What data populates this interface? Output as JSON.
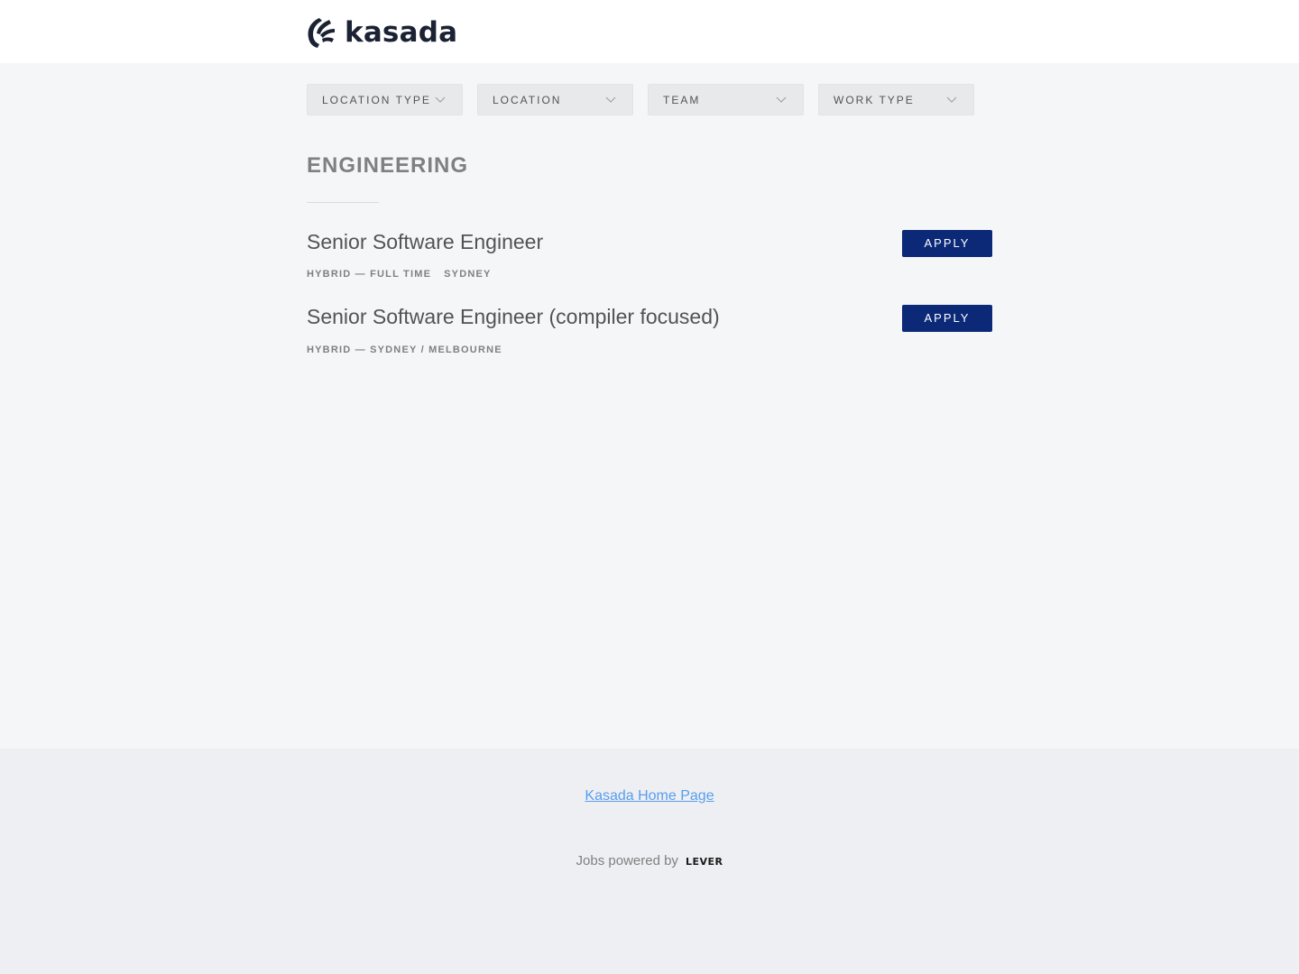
{
  "header": {
    "logo_text": "kasada",
    "brand_color": "#1a2233"
  },
  "filters": [
    {
      "label": "LOCATION TYPE"
    },
    {
      "label": "LOCATION"
    },
    {
      "label": "TEAM"
    },
    {
      "label": "WORK TYPE"
    }
  ],
  "team": {
    "heading": "ENGINEERING"
  },
  "postings": [
    {
      "title": "Senior Software Engineer",
      "meta_primary": "HYBRID — FULL TIME",
      "meta_secondary": "SYDNEY",
      "apply_label": "APPLY"
    },
    {
      "title": "Senior Software Engineer (compiler focused)",
      "meta_primary": "HYBRID — SYDNEY / MELBOURNE",
      "meta_secondary": "",
      "apply_label": "APPLY"
    }
  ],
  "colors": {
    "apply_button": "#0c2978",
    "link": "#579eee"
  },
  "footer": {
    "home_link": "Kasada Home Page",
    "powered_by": "Jobs powered by",
    "powered_brand": "LEVER"
  }
}
